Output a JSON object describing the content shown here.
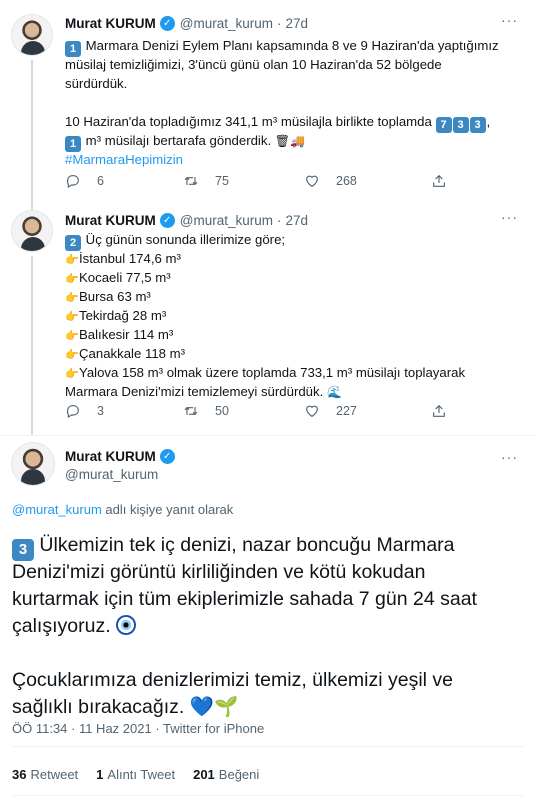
{
  "tweets": [
    {
      "name": "Murat KURUM",
      "handle": "@murat_kurum",
      "time": "27d",
      "lines": [
        "Marmara Denizi Eylem Planı kapsamında 8 ve 9 Haziran'da yaptığımız",
        "müsilaj temizliğimizi, 3'üncü günü olan 10 Haziran'da 52 bölgede",
        "sürdürdük.",
        "",
        "10 Haziran'da topladığımız 341,1 m³ müsilajla birlikte toplamda",
        "m³ müsilajı bertarafa gönderdik.",
        "#MarmaraHepimizin"
      ],
      "keycap_lead": "1",
      "keycap_total": [
        "7",
        "3",
        "3"
      ],
      "keycap_line6": "1",
      "replies": "6",
      "retweets": "75",
      "likes": "268"
    },
    {
      "name": "Murat KURUM",
      "handle": "@murat_kurum",
      "time": "27d",
      "keycap_lead": "2",
      "intro": "Üç günün sonunda illerimize göre;",
      "cities": [
        "İstanbul 174,6 m³",
        "Kocaeli 77,5 m³",
        "Bursa 63 m³",
        "Tekirdağ 28 m³",
        "Balıkesir 114 m³",
        "Çanakkale 118 m³",
        "Yalova 158 m³ olmak üzere toplamda 733,1 m³ müsilajı toplayarak"
      ],
      "outro": "Marmara Denizi'mizi temizlemeyi sürdürdük.",
      "replies": "3",
      "retweets": "50",
      "likes": "227"
    }
  ],
  "main": {
    "name": "Murat KURUM",
    "handle": "@murat_kurum",
    "reply_handle": "@murat_kurum",
    "reply_suffix": " adlı kişiye yanıt olarak",
    "keycap": "3",
    "lines": [
      "Ülkemizin tek iç denizi, nazar boncuğu Marmara",
      "Denizi'mizi görüntü kirliliğinden ve kötü kokudan",
      "kurtarmak için tüm ekiplerimizle sahada 7 gün 24 saat",
      "çalışıyoruz.",
      "",
      "Çocuklarımıza denizlerimizi temiz, ülkemizi yeşil ve",
      "sağlıklı bırakacağız."
    ],
    "timestamp": "ÖÖ 11:34 · 11 Haz 2021 · Twitter for iPhone",
    "retweets_count": "36",
    "retweets_label": "Retweet",
    "quotes_count": "1",
    "quotes_label": "Alıntı Tweet",
    "likes_count": "201",
    "likes_label": "Beğeni"
  },
  "icons": [
    "verified-badge-icon",
    "more-icon",
    "reply-icon",
    "retweet-icon",
    "like-icon",
    "share-icon",
    "finger-pointing-icon",
    "wastebasket-icon",
    "truck-icon",
    "wave-icon",
    "nazar-eye-icon",
    "blue-heart-icon",
    "seedling-icon"
  ],
  "colors": {
    "accent": "#1d9bf0",
    "muted": "#536471",
    "keycap": "#3b88c3"
  }
}
